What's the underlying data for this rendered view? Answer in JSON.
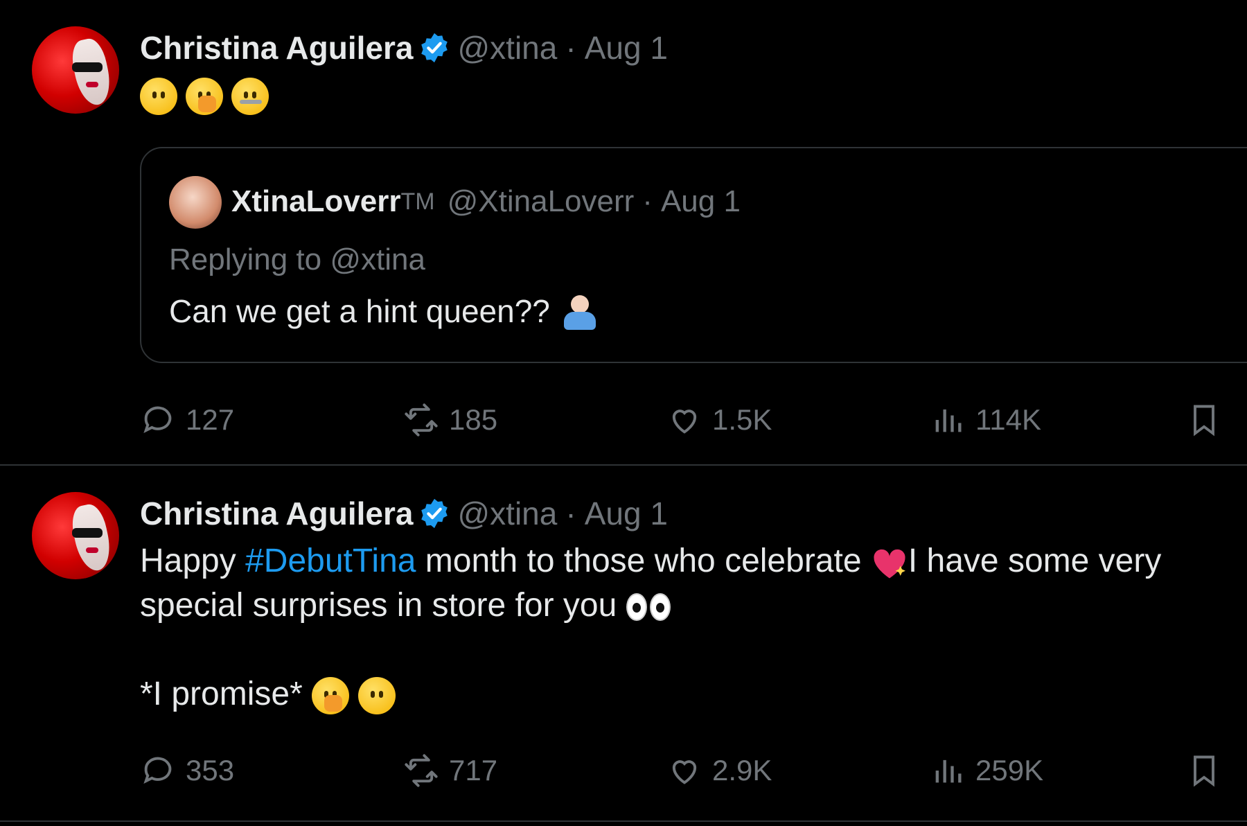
{
  "tweets": [
    {
      "author": {
        "name": "Christina Aguilera",
        "handle": "@xtina",
        "separator": "·",
        "date": "Aug 1"
      },
      "quote": {
        "author": {
          "name": "XtinaLoverr",
          "badge": "TM",
          "handle": "@XtinaLoverr",
          "separator": "·",
          "date": "Aug 1"
        },
        "replying_to": "Replying to @xtina",
        "text": "Can we get a hint queen??"
      },
      "stats": {
        "replies": "127",
        "reposts": "185",
        "likes": "1.5K",
        "views": "114K"
      }
    },
    {
      "author": {
        "name": "Christina Aguilera",
        "handle": "@xtina",
        "separator": "·",
        "date": "Aug 1"
      },
      "text": {
        "part1": "Happy ",
        "hashtag": "#DebutTina",
        "part2": " month to those who celebrate ",
        "part3": "I have some very",
        "line2": "special surprises in store for you ",
        "line3": "*I promise* "
      },
      "stats": {
        "replies": "353",
        "reposts": "717",
        "likes": "2.9K",
        "views": "259K"
      }
    }
  ],
  "icons": {
    "verified": "verified-badge-icon",
    "reply": "reply-bubble-icon",
    "repost": "repost-arrows-icon",
    "like": "heart-outline-icon",
    "views": "views-bar-chart-icon",
    "bookmark": "bookmark-icon"
  },
  "colors": {
    "background": "#000000",
    "text": "#e7e9ea",
    "muted": "#71767b",
    "accent": "#1d9bf0",
    "border": "#2f3336"
  }
}
